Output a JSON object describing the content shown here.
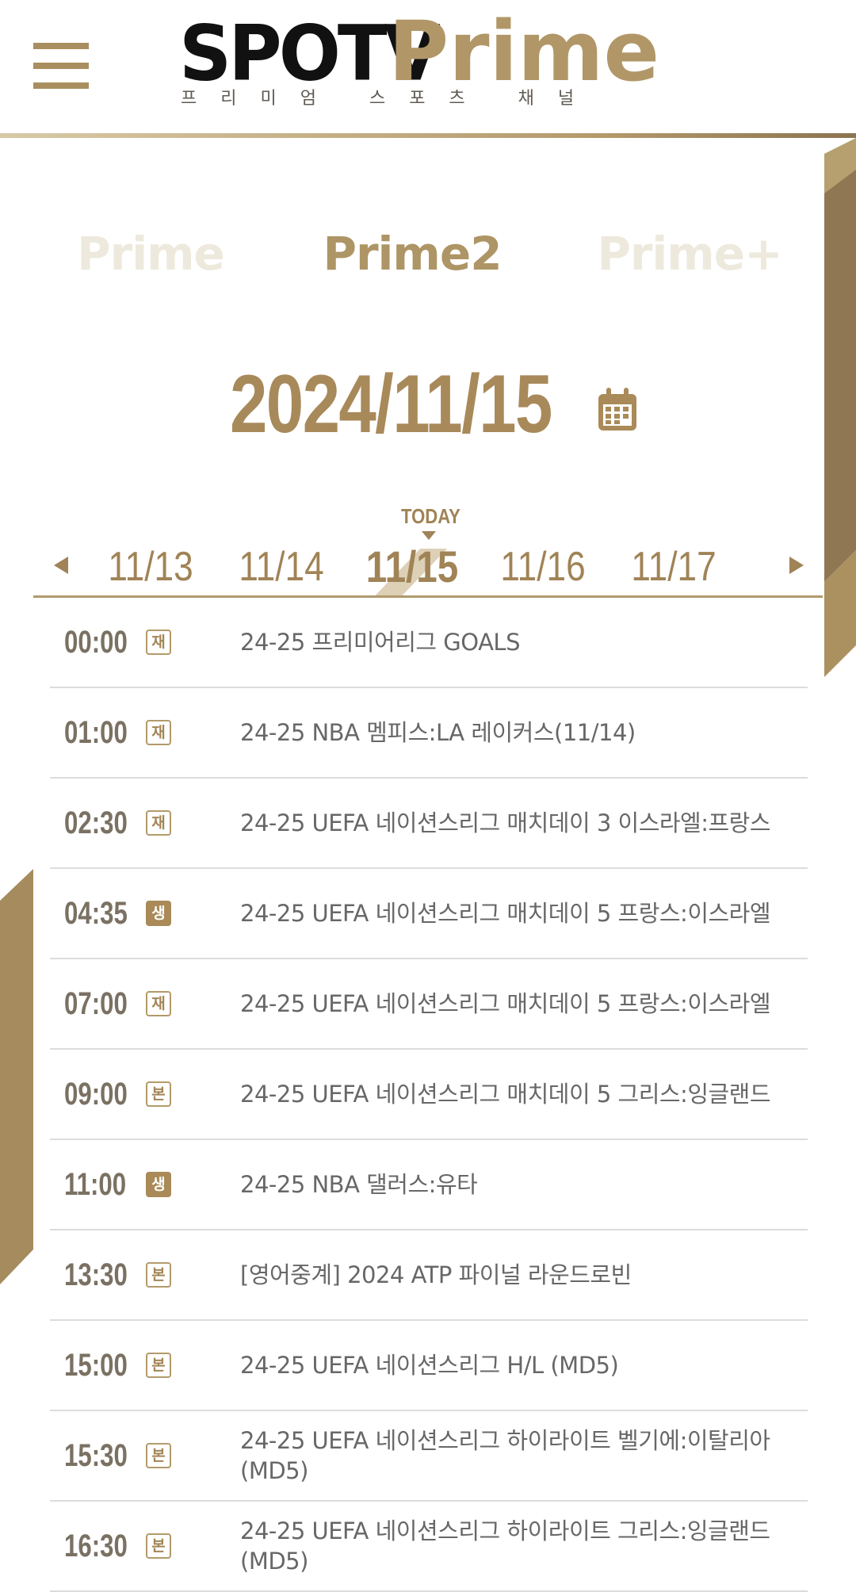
{
  "header": {
    "logo_spotv": "SPOTV",
    "logo_prime": "Prime",
    "logo_tagline": "프리미엄 스포츠 채널"
  },
  "channel_tabs": [
    {
      "label": "Prime",
      "active": false
    },
    {
      "label": "Prime2",
      "active": true
    },
    {
      "label": "Prime+",
      "active": false
    }
  ],
  "date_heading": "2024/11/15",
  "today_label": "TODAY",
  "dates": [
    "11/13",
    "11/14",
    "11/15",
    "11/16",
    "11/17"
  ],
  "active_date": "11/15",
  "colors": {
    "accent_gold": "#a98a58",
    "text_gray": "#676767",
    "divider": "#dcdcdc"
  },
  "schedule": [
    {
      "time": "00:00",
      "badge": "재",
      "badge_style": "outline",
      "title": "24-25 프리미어리그 GOALS"
    },
    {
      "time": "01:00",
      "badge": "재",
      "badge_style": "outline",
      "title": "24-25 NBA 멤피스:LA 레이커스(11/14)"
    },
    {
      "time": "02:30",
      "badge": "재",
      "badge_style": "outline",
      "title": "24-25 UEFA 네이션스리그 매치데이 3 이스라엘:프랑스"
    },
    {
      "time": "04:35",
      "badge": "생",
      "badge_style": "filled",
      "title": "24-25 UEFA 네이션스리그 매치데이 5 프랑스:이스라엘"
    },
    {
      "time": "07:00",
      "badge": "재",
      "badge_style": "outline",
      "title": "24-25 UEFA 네이션스리그 매치데이 5 프랑스:이스라엘"
    },
    {
      "time": "09:00",
      "badge": "본",
      "badge_style": "outline",
      "title": "24-25 UEFA 네이션스리그 매치데이 5 그리스:잉글랜드"
    },
    {
      "time": "11:00",
      "badge": "생",
      "badge_style": "filled",
      "title": "24-25 NBA 댈러스:유타"
    },
    {
      "time": "13:30",
      "badge": "본",
      "badge_style": "outline",
      "title": "[영어중계] 2024 ATP 파이널 라운드로빈"
    },
    {
      "time": "15:00",
      "badge": "본",
      "badge_style": "outline",
      "title": "24-25 UEFA 네이션스리그 H/L (MD5)"
    },
    {
      "time": "15:30",
      "badge": "본",
      "badge_style": "outline",
      "title": "24-25 UEFA 네이션스리그 하이라이트 벨기에:이탈리아 (MD5)"
    },
    {
      "time": "16:30",
      "badge": "본",
      "badge_style": "outline",
      "title": "24-25 UEFA 네이션스리그 하이라이트 그리스:잉글랜드 (MD5)"
    }
  ]
}
